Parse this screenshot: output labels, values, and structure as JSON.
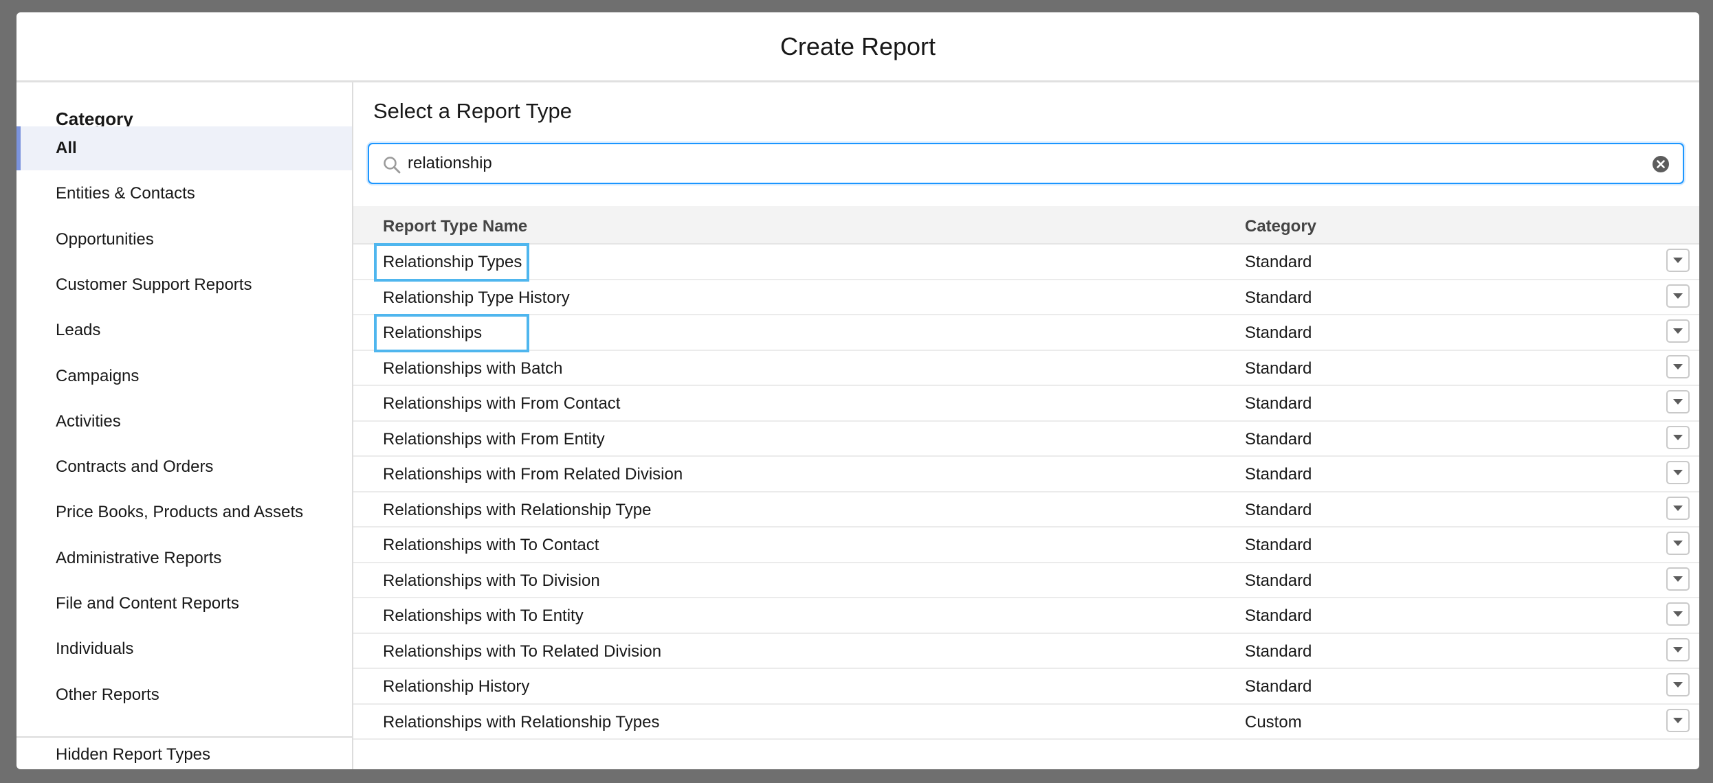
{
  "modal": {
    "title": "Create Report"
  },
  "sidebar": {
    "heading": "Category",
    "items": [
      {
        "label": "All",
        "active": true
      },
      {
        "label": "Entities & Contacts"
      },
      {
        "label": "Opportunities"
      },
      {
        "label": "Customer Support Reports"
      },
      {
        "label": "Leads"
      },
      {
        "label": "Campaigns"
      },
      {
        "label": "Activities"
      },
      {
        "label": "Contracts and Orders"
      },
      {
        "label": "Price Books, Products and Assets"
      },
      {
        "label": "Administrative Reports"
      },
      {
        "label": "File and Content Reports"
      },
      {
        "label": "Individuals"
      },
      {
        "label": "Other Reports"
      }
    ],
    "hidden_label": "Hidden Report Types"
  },
  "main": {
    "heading": "Select a Report Type",
    "search": {
      "value": "relationship",
      "icon": "search-icon",
      "clear_icon": "clear-icon"
    },
    "table": {
      "columns": [
        "Report Type Name",
        "Category"
      ],
      "rows": [
        {
          "name": "Relationship Types",
          "category": "Standard",
          "highlighted": true
        },
        {
          "name": "Relationship Type History",
          "category": "Standard"
        },
        {
          "name": "Relationships",
          "category": "Standard",
          "highlighted": true
        },
        {
          "name": "Relationships with Batch",
          "category": "Standard"
        },
        {
          "name": "Relationships with From Contact",
          "category": "Standard"
        },
        {
          "name": "Relationships with From Entity",
          "category": "Standard"
        },
        {
          "name": "Relationships with From Related Division",
          "category": "Standard"
        },
        {
          "name": "Relationships with Relationship Type",
          "category": "Standard"
        },
        {
          "name": "Relationships with To Contact",
          "category": "Standard"
        },
        {
          "name": "Relationships with To Division",
          "category": "Standard"
        },
        {
          "name": "Relationships with To Entity",
          "category": "Standard"
        },
        {
          "name": "Relationships with To Related Division",
          "category": "Standard"
        },
        {
          "name": "Relationship History",
          "category": "Standard"
        },
        {
          "name": "Relationships with Relationship Types",
          "category": "Custom"
        }
      ]
    }
  },
  "colors": {
    "highlight": "#4fb6ee",
    "focus": "#1b96ff",
    "active_bar": "#7b93dd"
  }
}
